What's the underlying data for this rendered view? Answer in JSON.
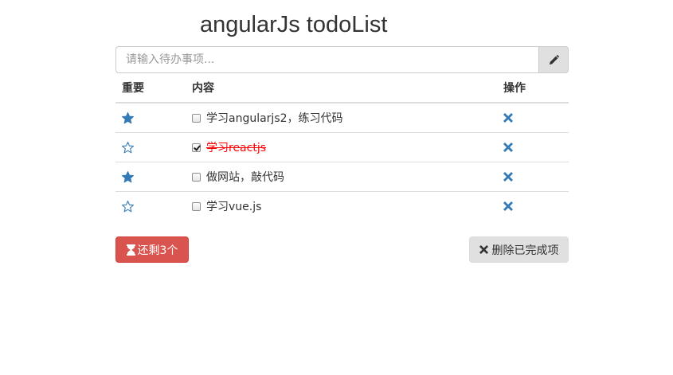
{
  "title": "angularJs todoList",
  "input": {
    "placeholder": "请输入待办事项...",
    "value": ""
  },
  "table": {
    "headers": {
      "important": "重要",
      "content": "内容",
      "action": "操作"
    },
    "rows": [
      {
        "important": true,
        "done": false,
        "text": "学习angularjs2，练习代码"
      },
      {
        "important": false,
        "done": true,
        "text": "学习reactjs"
      },
      {
        "important": true,
        "done": false,
        "text": "做网站，敲代码"
      },
      {
        "important": false,
        "done": false,
        "text": "学习vue.js"
      }
    ]
  },
  "footer": {
    "remaining_label": "还剩3个",
    "clear_label": "删除已完成项"
  },
  "colors": {
    "star": "#337ab7",
    "delete": "#337ab7",
    "done_text": "#ff0000",
    "danger": "#d9534f"
  }
}
